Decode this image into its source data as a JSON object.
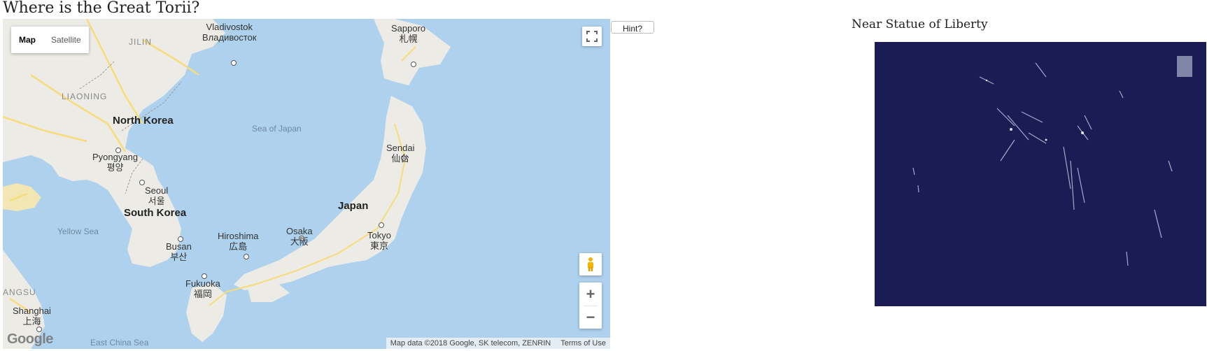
{
  "page": {
    "title": "Where is the Great Torii?",
    "hint_label": "Hint?"
  },
  "map": {
    "type_options": [
      "Map",
      "Satellite"
    ],
    "selected_type": "Map",
    "attribution": "Map data ©2018 Google, SK telecom, ZENRIN",
    "terms_label": "Terms of Use",
    "logo_text": "Google",
    "zoom_in_label": "+",
    "zoom_out_label": "−",
    "labels": {
      "vladivostok": "Vladivostok",
      "vladivostok_ru": "Владивосток",
      "sapporo": "Sapporo",
      "sapporo_jp": "札幌",
      "jilin": "JILIN",
      "liaoning": "LIAONING",
      "north_korea": "North Korea",
      "sea_of_japan": "Sea of Japan",
      "sendai": "Sendai",
      "sendai_jp": "仙台",
      "pyongyang": "Pyongyang",
      "pyongyang_kr": "평양",
      "seoul": "Seoul",
      "seoul_kr": "서울",
      "south_korea": "South Korea",
      "japan": "Japan",
      "yellow_sea": "Yellow Sea",
      "hiroshima": "Hiroshima",
      "hiroshima_jp": "広島",
      "osaka": "Osaka",
      "osaka_jp": "大阪",
      "tokyo": "Tokyo",
      "tokyo_jp": "東京",
      "busan": "Busan",
      "busan_kr": "부산",
      "fukuoka": "Fukuoka",
      "fukuoka_jp": "福岡",
      "jiangsu": "ANGSU",
      "shanghai": "Shanghai",
      "shanghai_cn": "上海",
      "east_china_sea": "East China Sea"
    }
  },
  "photo": {
    "caption": "Near Statue of Liberty"
  },
  "colors": {
    "water": "#aed1ed",
    "land": "#ecebe6",
    "highway": "#f7dc79",
    "photo_background": "#1c1c55"
  }
}
